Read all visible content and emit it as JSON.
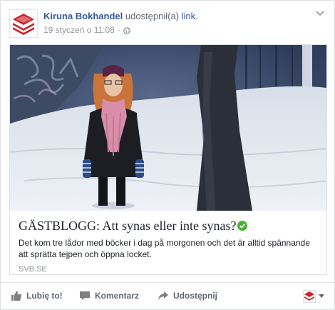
{
  "header": {
    "page_name": "Kiruna Bokhandel",
    "action_text": "udostępnił(a)",
    "action_link": "link.",
    "timestamp": "19 styczeń o 11:08",
    "separator": "·",
    "privacy_icon": "globe-icon",
    "menu_icon": "chevron-down-icon"
  },
  "link_card": {
    "title": "GÄSTBLOGG: Att synas eller inte synas?",
    "title_badge_icon": "verified-check-icon",
    "description": "Det kom tre lådor med böcker i dag på morgonen och det är alltid spännande att sprätta tejpen och öppna locket.",
    "domain": "SVB.SE",
    "image_icon": "photo-woman-in-snow"
  },
  "actions": {
    "like_label": "Lubię to!",
    "comment_label": "Komentarz",
    "share_label": "Udostępnij",
    "like_icon": "thumbs-up-icon",
    "comment_icon": "comment-icon",
    "share_icon": "share-arrow-icon",
    "audience_icon": "page-avatar-icon"
  },
  "colors": {
    "link_blue": "#365899",
    "meta_gray": "#90949c",
    "action_gray": "#616770",
    "check_green": "#42b72a",
    "logo_red": "#d0202a"
  }
}
